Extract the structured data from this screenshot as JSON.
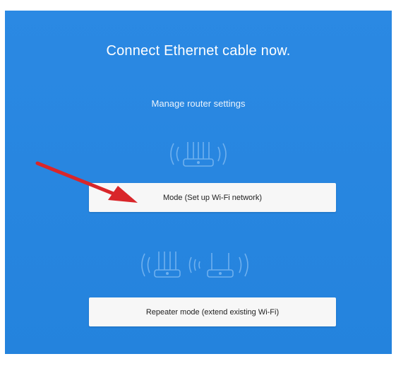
{
  "screen": {
    "title": "Connect Ethernet cable now.",
    "subtitle": "Manage router settings"
  },
  "options": {
    "mode_label": "Mode (Set up Wi-Fi network)",
    "repeater_label": "Repeater mode (extend existing Wi-Fi)"
  },
  "icons": {
    "router": "router-wifi-icon",
    "repeater": "repeater-wifi-icon",
    "pointer": "red-arrow-icon"
  },
  "colors": {
    "background": "#2a86e0",
    "button": "#f7f7f7",
    "arrow": "#d9262a"
  }
}
